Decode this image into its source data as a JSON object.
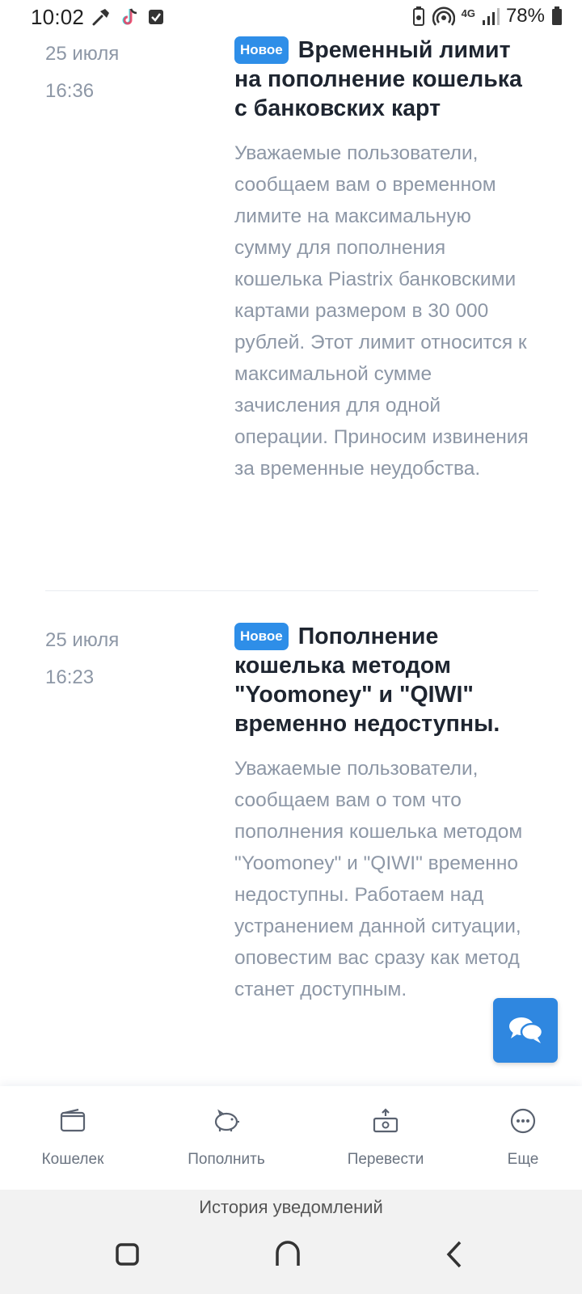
{
  "status_bar": {
    "time": "10:02",
    "left_icons": [
      "hammer-icon",
      "tiktok-icon",
      "checkbox-icon"
    ],
    "network": "4G",
    "battery": "78%"
  },
  "news": [
    {
      "date": "25 июля",
      "time": "16:36",
      "badge": "Новое",
      "title": "Временный лимит на пополнение кошелька с банковских карт",
      "body": "Уважаемые пользователи, сообщаем вам о временном лимите на максимальную сумму для пополнения кошелька Piastrix банковскими картами размером в 30 000 рублей. Этот лимит относится к максимальной сумме зачисления для одной операции. Приносим извинения за временные неудобства."
    },
    {
      "date": "25 июля",
      "time": "16:23",
      "badge": "Новое",
      "title": "Пополнение кошелька методом \"Yoomoney\" и \"QIWI\" временно недоступны.",
      "body": "Уважаемые пользователи, сообщаем вам о том что пополнения кошелька методом \"Yoomoney\" и \"QIWI\" временно недоступны. Работаем над устранением данной ситуации, оповестим вас сразу как метод станет доступным."
    }
  ],
  "bottom_nav": {
    "items": [
      {
        "label": "Кошелек",
        "icon": "wallet-icon"
      },
      {
        "label": "Пополнить",
        "icon": "piggy-bank-icon"
      },
      {
        "label": "Перевести",
        "icon": "transfer-icon"
      },
      {
        "label": "Еще",
        "icon": "more-icon"
      }
    ]
  },
  "history_bar": {
    "title": "История уведомлений"
  },
  "colors": {
    "accent": "#2e8ee8",
    "muted_text": "#8d97a6",
    "title_text": "#1e2530"
  }
}
